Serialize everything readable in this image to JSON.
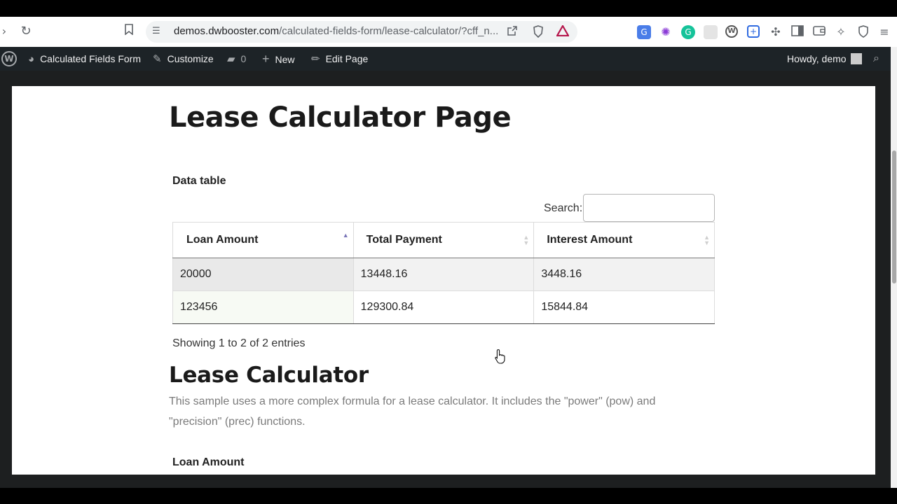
{
  "browser": {
    "url_host": "demos.dwbooster.com",
    "url_path": "/calculated-fields-form/lease-calculator/?cff_n..."
  },
  "admin_bar": {
    "site_name": "Calculated Fields Form",
    "customize": "Customize",
    "comments_count": "0",
    "new": "New",
    "edit_page": "Edit Page",
    "howdy": "Howdy, demo"
  },
  "page": {
    "title": "Lease Calculator Page",
    "table_caption": "Data table",
    "search_label": "Search:",
    "search_value": "",
    "columns": [
      "Loan Amount",
      "Total Payment",
      "Interest Amount"
    ],
    "rows": [
      [
        "20000",
        "13448.16",
        "3448.16"
      ],
      [
        "123456",
        "129300.84",
        "15844.84"
      ]
    ],
    "info": "Showing 1 to 2 of 2 entries",
    "section_title": "Lease Calculator",
    "section_desc": "This sample uses a more complex formula for a lease calculator. It includes the \"power\" (pow) and \"precision\" (prec) functions.",
    "field_label": "Loan Amount"
  }
}
